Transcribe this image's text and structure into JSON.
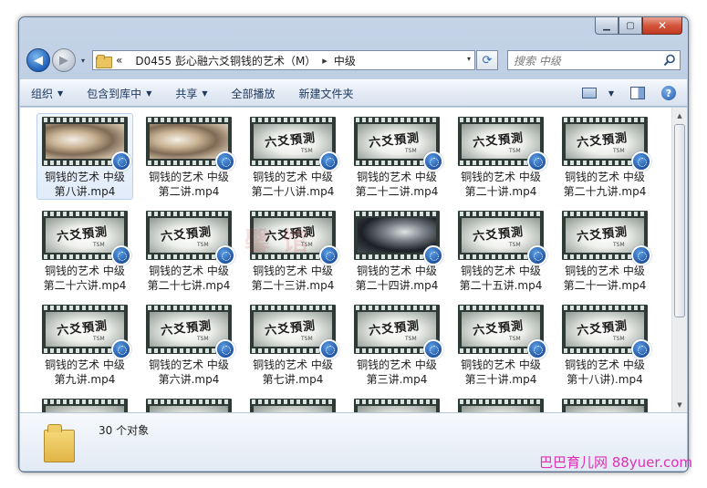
{
  "window": {
    "minimize_glyph": "▁",
    "maximize_glyph": "▢",
    "close_glyph": "✕"
  },
  "nav": {
    "back_glyph": "◀",
    "forward_glyph": "▶",
    "history_glyph": "▾",
    "breadcrumb_overflow": "«",
    "breadcrumb": [
      "D0455 彭心融六爻铜钱的艺术（M）",
      "中级"
    ],
    "crumb_separator": "▸",
    "address_dropdown_glyph": "▾",
    "refresh_glyph": "⟳",
    "search_placeholder": "搜索 中级"
  },
  "toolbar": {
    "organize": "组织",
    "include_library": "包含到库中",
    "share": "共享",
    "play_all": "全部播放",
    "new_folder": "新建文件夹",
    "dropdown_glyph": "▼",
    "help_glyph": "?"
  },
  "files": [
    {
      "line1": "铜钱的艺术 中级",
      "line2": "第八讲.mp4",
      "thumb": "smoke",
      "selected": true
    },
    {
      "line1": "铜钱的艺术 中级",
      "line2": "第二讲.mp4",
      "thumb": "smoke"
    },
    {
      "line1": "铜钱的艺术 中级",
      "line2": "第二十八讲.mp4",
      "thumb": "title"
    },
    {
      "line1": "铜钱的艺术 中级",
      "line2": "第二十二讲.mp4",
      "thumb": "title"
    },
    {
      "line1": "铜钱的艺术 中级",
      "line2": "第二十讲.mp4",
      "thumb": "title"
    },
    {
      "line1": "铜钱的艺术 中级",
      "line2": "第二十九讲.mp4",
      "thumb": "title"
    },
    {
      "line1": "铜钱的艺术 中级",
      "line2": "第二十六讲.mp4",
      "thumb": "title"
    },
    {
      "line1": "铜钱的艺术 中级",
      "line2": "第二十七讲.mp4",
      "thumb": "title"
    },
    {
      "line1": "铜钱的艺术 中级",
      "line2": "第二十三讲.mp4",
      "thumb": "title"
    },
    {
      "line1": "铜钱的艺术 中级",
      "line2": "第二十四讲.mp4",
      "thumb": "dark"
    },
    {
      "line1": "铜钱的艺术 中级",
      "line2": "第二十五讲.mp4",
      "thumb": "title"
    },
    {
      "line1": "铜钱的艺术 中级",
      "line2": "第二十一讲.mp4",
      "thumb": "title"
    },
    {
      "line1": "铜钱的艺术 中级",
      "line2": "第九讲.mp4",
      "thumb": "title"
    },
    {
      "line1": "铜钱的艺术 中级",
      "line2": "第六讲.mp4",
      "thumb": "title"
    },
    {
      "line1": "铜钱的艺术 中级",
      "line2": "第七讲.mp4",
      "thumb": "title"
    },
    {
      "line1": "铜钱的艺术 中级",
      "line2": "第三讲.mp4",
      "thumb": "title"
    },
    {
      "line1": "铜钱的艺术 中级",
      "line2": "第三十讲.mp4",
      "thumb": "title"
    },
    {
      "line1": "铜钱的艺术 中级",
      "line2": "第十八讲).mp4",
      "thumb": "title"
    },
    {
      "line1": "",
      "line2": "",
      "thumb": "title"
    },
    {
      "line1": "",
      "line2": "",
      "thumb": "title"
    },
    {
      "line1": "",
      "line2": "",
      "thumb": "title"
    },
    {
      "line1": "",
      "line2": "",
      "thumb": "title"
    },
    {
      "line1": "",
      "line2": "",
      "thumb": "title"
    },
    {
      "line1": "",
      "line2": "",
      "thumb": "title"
    }
  ],
  "thumb_title_text": "六爻預測",
  "thumb_sub_text": "TSM",
  "scrollbar": {
    "up_glyph": "▲",
    "down_glyph": "▼"
  },
  "status": {
    "object_count": "30 个对象"
  },
  "overlay": {
    "watermark": "馨 馆",
    "footer_brand": "巴巴育儿网 88yuer.com"
  },
  "colors": {
    "accent": "#1f5fb8",
    "toolbar_text": "#1e3960",
    "brand_magenta": "#e02fb6"
  }
}
